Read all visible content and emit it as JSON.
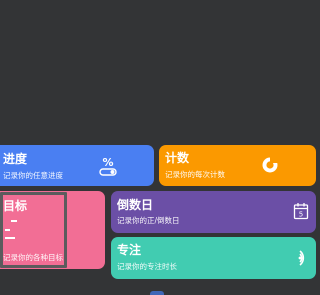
{
  "cards": {
    "progress": {
      "title": "进度",
      "subtitle": "记录你的任意进度",
      "color": "#4a7ff2",
      "icon": "percent-toggle-icon"
    },
    "count": {
      "title": "计数",
      "subtitle": "记录你的每次计数",
      "color": "#fb9900",
      "icon": "counter-ring-icon"
    },
    "goal": {
      "title": "目标",
      "subtitle": "记录你的各种目标",
      "color": "#f26e95",
      "icon": "goal-bars-icon"
    },
    "countdown": {
      "title": "倒数日",
      "subtitle": "记录你的正/倒数日",
      "color": "#6b4fa6",
      "icon": "calendar-icon"
    },
    "focus": {
      "title": "专注",
      "subtitle": "记录你的专注时长",
      "color": "#41ccb1",
      "icon": "focus-arc-icon"
    }
  }
}
